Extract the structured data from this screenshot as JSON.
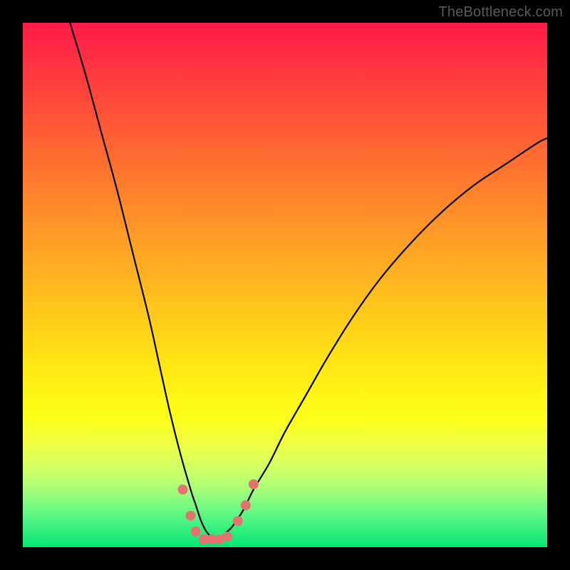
{
  "watermark": "TheBottleneck.com",
  "chart_data": {
    "type": "line",
    "title": "",
    "xlabel": "",
    "ylabel": "",
    "xlim": [
      0,
      100
    ],
    "ylim": [
      0,
      100
    ],
    "grid": false,
    "legend": false,
    "series": [
      {
        "name": "bottleneck-curve",
        "color": "#000000",
        "x": [
          9,
          12,
          15,
          18,
          21,
          24,
          26,
          28,
          30,
          32,
          33,
          34,
          35,
          36,
          37,
          38,
          39,
          40,
          42,
          44,
          47,
          50,
          54,
          58,
          63,
          68,
          74,
          80,
          86,
          92,
          98,
          100
        ],
        "y": [
          100,
          90,
          79,
          68,
          56,
          44,
          35,
          26,
          18,
          11,
          8,
          5,
          3,
          2,
          2,
          2,
          3,
          4,
          7,
          11,
          16,
          22,
          29,
          36,
          44,
          51,
          58,
          64,
          69,
          73,
          77,
          78
        ]
      }
    ],
    "markers": [
      {
        "name": "dot-left-1",
        "x": 30.5,
        "y": 11,
        "color": "#e4736f",
        "r": 7
      },
      {
        "name": "dot-left-2",
        "x": 32.0,
        "y": 6,
        "color": "#e4736f",
        "r": 7
      },
      {
        "name": "dot-left-3",
        "x": 33.0,
        "y": 3,
        "color": "#e4736f",
        "r": 7
      },
      {
        "name": "dot-bottom-1",
        "x": 34.5,
        "y": 1.5,
        "color": "#e4736f",
        "r": 7
      },
      {
        "name": "dot-bottom-2",
        "x": 36.0,
        "y": 1.5,
        "color": "#e4736f",
        "r": 7
      },
      {
        "name": "dot-bottom-3",
        "x": 37.5,
        "y": 1.5,
        "color": "#e4736f",
        "r": 7
      },
      {
        "name": "dot-bottom-4",
        "x": 39.0,
        "y": 2,
        "color": "#e4736f",
        "r": 7
      },
      {
        "name": "dot-right-1",
        "x": 41.0,
        "y": 5,
        "color": "#e4736f",
        "r": 7
      },
      {
        "name": "dot-right-2",
        "x": 42.5,
        "y": 8,
        "color": "#e4736f",
        "r": 7
      },
      {
        "name": "dot-right-3",
        "x": 44.0,
        "y": 12,
        "color": "#e4736f",
        "r": 7
      }
    ]
  }
}
